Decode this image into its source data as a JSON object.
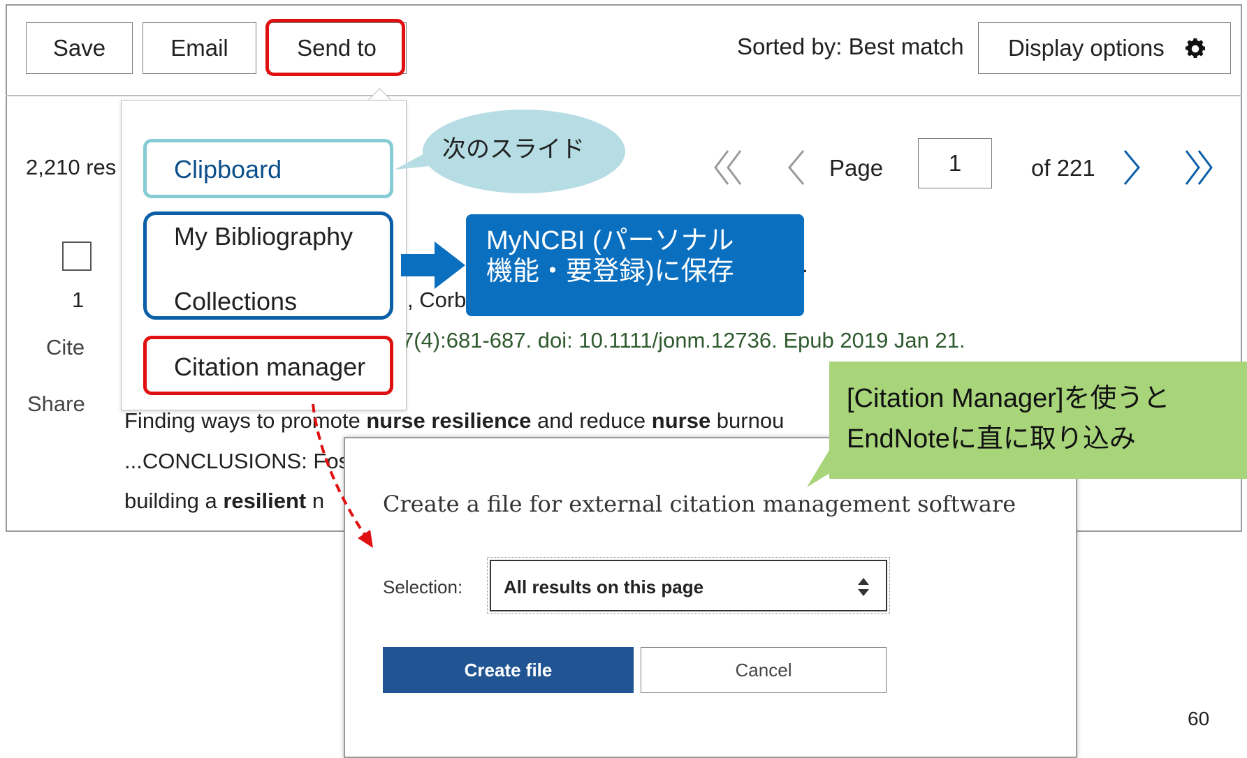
{
  "toolbar": {
    "save_label": "Save",
    "email_label": "Email",
    "send_to_label": "Send to",
    "sorted_by": "Sorted by: Best match",
    "display_options_label": "Display options"
  },
  "results": {
    "count_text": "2,210 res",
    "page_label": "Page",
    "page_value": "1",
    "page_total": "of 221"
  },
  "send_to_menu": {
    "items": [
      "Clipboard",
      "My Bibliography",
      "Collections",
      "Citation manager"
    ]
  },
  "article": {
    "checkbox_number": "1",
    "cite_label": "Cite",
    "share_label": "Share",
    "authors_fragment": ", Corb",
    "citation_fragment": "7(4):681-687. doi: 10.1111/jonm.12736. Epub 2019 Jan 21.",
    "snippet_line1": [
      {
        "text": "Finding ways to promote ",
        "bold": false
      },
      {
        "text": "nurse resilience",
        "bold": true
      },
      {
        "text": " and reduce ",
        "bold": false
      },
      {
        "text": "nurse",
        "bold": true
      },
      {
        "text": " burnou",
        "bold": false
      }
    ],
    "snippet_line2": "...CONCLUSIONS: Fos",
    "snippet_line3_pre": "building a ",
    "snippet_line3_bold": "resilient",
    "snippet_line3_post": " n"
  },
  "callouts": {
    "next_slide": "次のスライド",
    "myncbi_line1": "MyNCBI (パーソナル",
    "myncbi_line2": "機能・要登録)に保存",
    "citation_manager_line1": "[Citation Manager]を使うと",
    "citation_manager_line2": "EndNoteに直に取り込み"
  },
  "modal": {
    "title": "Create a file for external citation management software",
    "selection_label": "Selection:",
    "selection_value": "All results on this page",
    "create_button": "Create file",
    "cancel_button": "Cancel"
  },
  "slide_number": "60",
  "colors": {
    "highlight_red": "#e01010",
    "clipboard_box": "#86ccd4",
    "bibliography_box": "#0b5fa8",
    "callout_blue": "#0b6fbf",
    "callout_green": "#a8d47a",
    "callout_light_blue": "#b6dde4",
    "primary_button": "#205493"
  },
  "icons": [
    "gear-icon",
    "double-chevron-left-icon",
    "chevron-left-icon",
    "chevron-right-icon",
    "double-chevron-right-icon",
    "sort-arrows-icon",
    "arrow-right-icon"
  ]
}
